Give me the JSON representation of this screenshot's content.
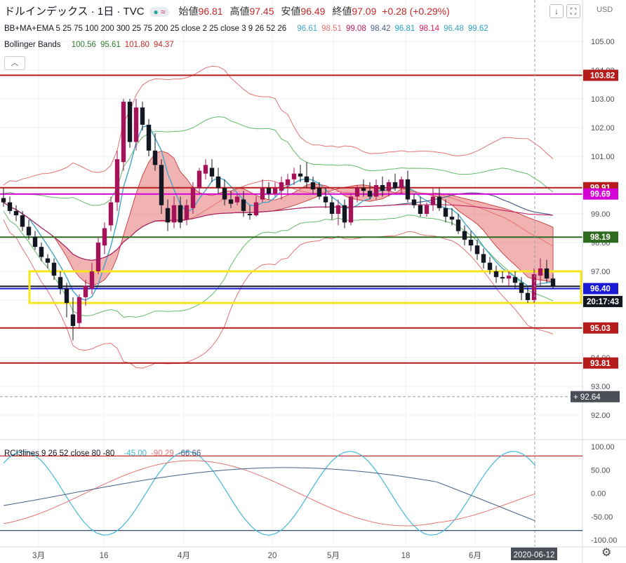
{
  "header": {
    "symbol": "ドルインデックス · 1日 · TVC",
    "open_label": "始値",
    "open": "96.81",
    "high_label": "高値",
    "high": "97.45",
    "low_label": "安値",
    "low": "96.49",
    "close_label": "終値",
    "close": "97.09",
    "change": "+0.28 (+0.29%)",
    "currency": "USD",
    "down_arrow_icon": "arrow-down-icon",
    "fullscreen_icon": "fullscreen-icon",
    "collapse_icon": "chevron-up-icon"
  },
  "indicators": {
    "bb_ma_ema": {
      "label": "BB+MA+EMA 5 25 75 100 200 300 25 75 200 25 close 2 25 close 3 9 26 52 26",
      "values": [
        {
          "v": "96.61",
          "color": "#42a5c8"
        },
        {
          "v": "98.51",
          "color": "#e57373"
        },
        {
          "v": "99.08",
          "color": "#c2185b"
        },
        {
          "v": "98.42",
          "color": "#4a5f8a"
        },
        {
          "v": "96.81",
          "color": "#26a0c8"
        },
        {
          "v": "98.14",
          "color": "#d81b60"
        },
        {
          "v": "96.48",
          "color": "#42a5c8"
        },
        {
          "v": "99.62",
          "color": "#26a0c8"
        }
      ]
    },
    "bollinger": {
      "label": "Bollinger Bands",
      "values": [
        {
          "v": "100.56",
          "color": "#2e7d32"
        },
        {
          "v": "95.61",
          "color": "#2e7d32"
        },
        {
          "v": "101.80",
          "color": "#c62828"
        },
        {
          "v": "94.37",
          "color": "#c62828"
        }
      ]
    },
    "rci": {
      "label": "RCI3lines 9 26 52 close 80 -80",
      "values": [
        {
          "v": "-45.00",
          "color": "#42b8d8"
        },
        {
          "v": "-90.29",
          "color": "#e57373"
        },
        {
          "v": "-66.66",
          "color": "#4a5f8a"
        }
      ]
    }
  },
  "chart_data": {
    "type": "candlestick",
    "y_axis_ticks": [
      "105.00",
      "104.00",
      "103.00",
      "102.00",
      "101.00",
      "100.00",
      "99.00",
      "98.00",
      "97.00",
      "96.00",
      "95.00",
      "94.00",
      "93.00",
      "92.00"
    ],
    "x_axis_ticks": [
      "3月",
      "16",
      "4月",
      "20",
      "5月",
      "18",
      "6月"
    ],
    "ylim": [
      91.0,
      106.2
    ],
    "horizontal_levels": [
      {
        "value": 103.82,
        "label": "103.82",
        "color": "#b71c1c"
      },
      {
        "value": 99.91,
        "label": "99.91",
        "color": "#b71c1c"
      },
      {
        "value": 99.69,
        "label": "99.69",
        "color": "#d500d5"
      },
      {
        "value": 98.19,
        "label": "98.19",
        "color": "#2e6b1f"
      },
      {
        "value": 96.48,
        "label": "96.48",
        "color": "#131722"
      },
      {
        "value": 96.4,
        "label": "96.40",
        "color": "#1a1ad6"
      },
      {
        "value": 95.03,
        "label": "95.03",
        "color": "#b71c1c"
      },
      {
        "value": 93.81,
        "label": "93.81",
        "color": "#b71c1c"
      }
    ],
    "countdown": "20:17:43",
    "crosshair": {
      "price": "92.64",
      "date": "2020-06-12"
    },
    "highlight_zone": [
      95.9,
      97.0
    ],
    "candles": [
      [
        99.55,
        99.9,
        99.25,
        99.4
      ],
      [
        99.4,
        99.6,
        99.0,
        99.1
      ],
      [
        99.1,
        99.3,
        98.75,
        98.95
      ],
      [
        98.95,
        99.1,
        98.4,
        98.55
      ],
      [
        98.55,
        98.8,
        98.1,
        98.25
      ],
      [
        98.2,
        98.4,
        97.75,
        97.85
      ],
      [
        97.85,
        98.0,
        97.35,
        97.5
      ],
      [
        97.45,
        97.6,
        97.1,
        97.3
      ],
      [
        97.3,
        97.45,
        96.7,
        96.85
      ],
      [
        96.8,
        97.0,
        96.2,
        96.4
      ],
      [
        96.4,
        96.6,
        95.4,
        95.9
      ],
      [
        95.5,
        96.1,
        94.6,
        95.1
      ],
      [
        95.2,
        96.2,
        95.0,
        96.1
      ],
      [
        96.1,
        96.7,
        95.8,
        96.5
      ],
      [
        96.4,
        97.3,
        96.2,
        97.0
      ],
      [
        97.0,
        98.2,
        96.9,
        98.0
      ],
      [
        97.9,
        98.7,
        97.6,
        98.5
      ],
      [
        98.6,
        99.6,
        98.4,
        99.4
      ],
      [
        99.4,
        101.2,
        99.1,
        100.9
      ],
      [
        100.8,
        103.0,
        100.5,
        102.9
      ],
      [
        102.9,
        103.0,
        101.3,
        101.5
      ],
      [
        101.5,
        103.0,
        101.2,
        102.7
      ],
      [
        102.7,
        102.9,
        101.9,
        102.1
      ],
      [
        102.1,
        102.3,
        101.0,
        101.2
      ],
      [
        101.2,
        101.8,
        100.5,
        100.7
      ],
      [
        100.7,
        100.9,
        99.0,
        99.3
      ],
      [
        99.2,
        99.5,
        98.4,
        98.7
      ],
      [
        98.7,
        99.6,
        98.5,
        99.3
      ],
      [
        99.3,
        99.6,
        98.5,
        98.7
      ],
      [
        98.8,
        99.5,
        98.6,
        99.3
      ],
      [
        99.2,
        100.1,
        99.0,
        99.9
      ],
      [
        99.9,
        100.6,
        99.7,
        100.5
      ],
      [
        100.4,
        100.9,
        100.2,
        100.7
      ],
      [
        100.6,
        100.9,
        100.1,
        100.3
      ],
      [
        100.3,
        100.6,
        99.7,
        99.9
      ],
      [
        99.9,
        100.2,
        99.3,
        99.5
      ],
      [
        99.5,
        99.8,
        99.2,
        99.35
      ],
      [
        99.4,
        99.7,
        99.3,
        99.6
      ],
      [
        99.5,
        99.8,
        98.9,
        99.1
      ],
      [
        99.0,
        99.3,
        98.8,
        98.95
      ],
      [
        98.95,
        99.6,
        98.9,
        99.4
      ],
      [
        99.5,
        100.2,
        99.4,
        99.9
      ],
      [
        99.9,
        100.1,
        99.5,
        99.7
      ],
      [
        99.7,
        100.1,
        99.6,
        99.9
      ],
      [
        99.8,
        100.3,
        99.5,
        100.1
      ],
      [
        100.0,
        100.4,
        99.7,
        100.2
      ],
      [
        100.2,
        100.6,
        100.0,
        100.4
      ],
      [
        100.4,
        100.7,
        100.1,
        100.3
      ],
      [
        100.3,
        100.8,
        99.9,
        100.1
      ],
      [
        100.1,
        100.3,
        99.7,
        99.85
      ],
      [
        99.9,
        100.1,
        99.5,
        99.6
      ],
      [
        99.6,
        99.9,
        99.2,
        99.4
      ],
      [
        99.4,
        99.6,
        98.8,
        99.0
      ],
      [
        99.0,
        99.5,
        98.6,
        99.3
      ],
      [
        99.3,
        99.5,
        98.5,
        98.7
      ],
      [
        98.7,
        99.7,
        98.6,
        99.6
      ],
      [
        99.6,
        100.0,
        99.4,
        99.9
      ],
      [
        99.9,
        100.2,
        99.6,
        99.8
      ],
      [
        99.8,
        100.1,
        99.5,
        99.6
      ],
      [
        99.6,
        100.2,
        99.5,
        100.0
      ],
      [
        100.0,
        100.3,
        99.6,
        99.8
      ],
      [
        99.8,
        100.2,
        99.6,
        100.1
      ],
      [
        100.1,
        100.4,
        99.8,
        99.9
      ],
      [
        99.9,
        100.3,
        99.7,
        100.2
      ],
      [
        100.2,
        100.5,
        99.4,
        99.5
      ],
      [
        99.5,
        99.7,
        99.2,
        99.3
      ],
      [
        99.3,
        99.6,
        98.9,
        99.0
      ],
      [
        99.0,
        99.4,
        98.9,
        99.3
      ],
      [
        99.3,
        99.9,
        99.1,
        99.6
      ],
      [
        99.6,
        99.9,
        99.1,
        99.2
      ],
      [
        99.2,
        99.5,
        98.7,
        98.9
      ],
      [
        98.9,
        99.2,
        98.6,
        98.8
      ],
      [
        98.8,
        99.0,
        98.3,
        98.4
      ],
      [
        98.4,
        98.6,
        97.9,
        98.1
      ],
      [
        98.1,
        98.4,
        97.7,
        97.9
      ],
      [
        97.9,
        98.1,
        97.4,
        97.6
      ],
      [
        97.6,
        97.8,
        97.1,
        97.3
      ],
      [
        97.3,
        97.5,
        96.9,
        97.05
      ],
      [
        97.0,
        97.2,
        96.6,
        96.8
      ],
      [
        96.8,
        97.0,
        96.6,
        96.75
      ],
      [
        96.75,
        97.0,
        96.5,
        96.85
      ],
      [
        96.8,
        97.0,
        96.4,
        96.6
      ],
      [
        96.6,
        96.8,
        96.0,
        96.25
      ],
      [
        96.25,
        96.5,
        95.9,
        96.0
      ],
      [
        96.0,
        97.1,
        95.9,
        96.9
      ],
      [
        96.85,
        97.45,
        96.5,
        97.1
      ],
      [
        97.1,
        97.4,
        96.6,
        96.75
      ],
      [
        96.75,
        96.9,
        96.4,
        96.48
      ]
    ]
  }
}
